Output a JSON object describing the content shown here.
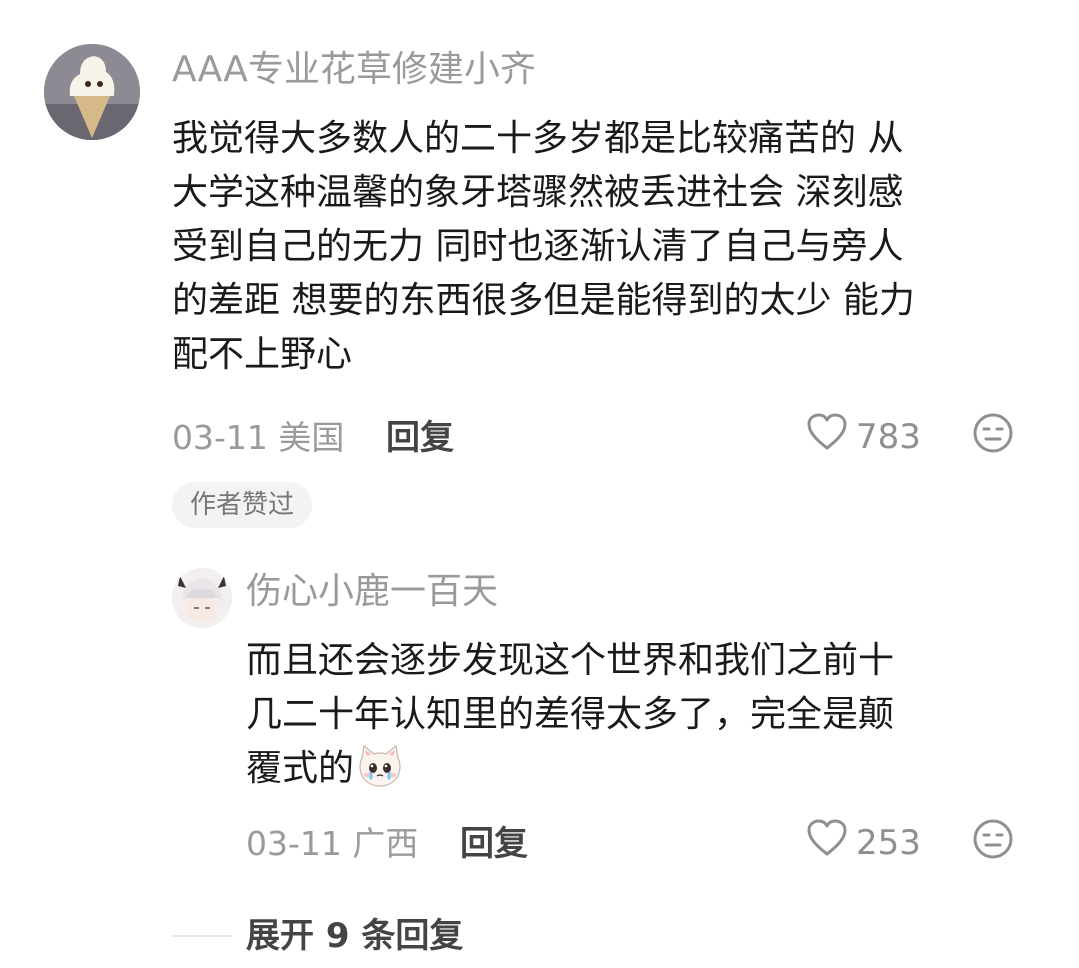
{
  "comment": {
    "username": "AAA专业花草修建小齐",
    "text_lines": [
      "我觉得大多数人的二十多岁都是比较痛苦的 从",
      "大学这种温馨的象牙塔骤然被丢进社会 深刻感",
      "受到自己的无力 同时也逐渐认清了自己与旁人",
      "的差距 想要的东西很多但是能得到的太少 能力",
      "配不上野心"
    ],
    "date_location": "03-11 美国",
    "reply_label": "回复",
    "like_count": "783",
    "author_badge": "作者赞过"
  },
  "reply": {
    "username": "伤心小鹿一百天",
    "text_lines": [
      "而且还会逐步发现这个世界和我们之前十",
      "几二十年认知里的差得太多了，完全是颠",
      "覆式的"
    ],
    "date_location": "03-11 广西",
    "reply_label": "回复",
    "like_count": "253"
  },
  "expand_label": "展开 9 条回复",
  "icons": {
    "heart": "heart-outline-icon",
    "dislike": "neutral-face-icon",
    "emoji": "crying-cat-emoji"
  }
}
